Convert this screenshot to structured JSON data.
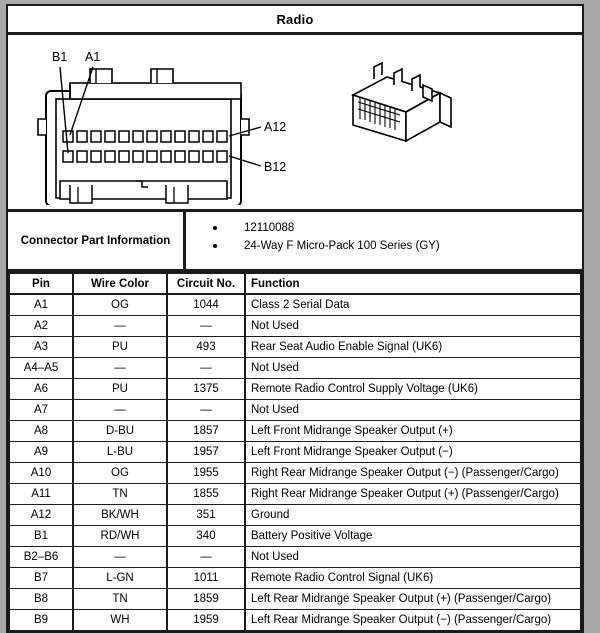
{
  "document": {
    "title": "Radio"
  },
  "diagram": {
    "callouts": {
      "b1": "B1",
      "a1": "A1",
      "a12": "A12",
      "b12": "B12"
    },
    "connector_face_name": "connector-face-front-view",
    "connector_iso_name": "connector-isometric-view",
    "pin_rows": 2,
    "pin_columns": 12
  },
  "connector_part_information": {
    "label": "Connector Part Information",
    "items": [
      "12110088",
      "24-Way F Micro-Pack 100 Series (GY)"
    ]
  },
  "pin_table": {
    "headers": {
      "pin": "Pin",
      "wire_color": "Wire Color",
      "circuit_no": "Circuit No.",
      "function": "Function"
    },
    "rows": [
      {
        "pin": "A1",
        "wire_color": "OG",
        "circuit_no": "1044",
        "function": "Class 2 Serial Data"
      },
      {
        "pin": "A2",
        "wire_color": "—",
        "circuit_no": "—",
        "function": "Not Used"
      },
      {
        "pin": "A3",
        "wire_color": "PU",
        "circuit_no": "493",
        "function": "Rear Seat Audio Enable Signal (UK6)"
      },
      {
        "pin": "A4–A5",
        "wire_color": "—",
        "circuit_no": "—",
        "function": "Not Used"
      },
      {
        "pin": "A6",
        "wire_color": "PU",
        "circuit_no": "1375",
        "function": "Remote Radio Control Supply Voltage (UK6)"
      },
      {
        "pin": "A7",
        "wire_color": "—",
        "circuit_no": "—",
        "function": "Not Used"
      },
      {
        "pin": "A8",
        "wire_color": "D-BU",
        "circuit_no": "1857",
        "function": "Left Front Midrange Speaker Output (+)"
      },
      {
        "pin": "A9",
        "wire_color": "L-BU",
        "circuit_no": "1957",
        "function": "Left Front Midrange Speaker Output (−)"
      },
      {
        "pin": "A10",
        "wire_color": "OG",
        "circuit_no": "1955",
        "function": "Right Rear Midrange Speaker Output (−) (Passenger/Cargo)"
      },
      {
        "pin": "A11",
        "wire_color": "TN",
        "circuit_no": "1855",
        "function": "Right Rear Midrange Speaker Output (+) (Passenger/Cargo)"
      },
      {
        "pin": "A12",
        "wire_color": "BK/WH",
        "circuit_no": "351",
        "function": "Ground"
      },
      {
        "pin": "B1",
        "wire_color": "RD/WH",
        "circuit_no": "340",
        "function": "Battery Positive Voltage"
      },
      {
        "pin": "B2–B6",
        "wire_color": "—",
        "circuit_no": "—",
        "function": "Not Used"
      },
      {
        "pin": "B7",
        "wire_color": "L-GN",
        "circuit_no": "1011",
        "function": "Remote Radio Control Signal (UK6)"
      },
      {
        "pin": "B8",
        "wire_color": "TN",
        "circuit_no": "1859",
        "function": "Left Rear Midrange Speaker Output (+) (Passenger/Cargo)"
      },
      {
        "pin": "B9",
        "wire_color": "WH",
        "circuit_no": "1959",
        "function": "Left Rear Midrange Speaker Output (−) (Passenger/Cargo)"
      }
    ]
  }
}
